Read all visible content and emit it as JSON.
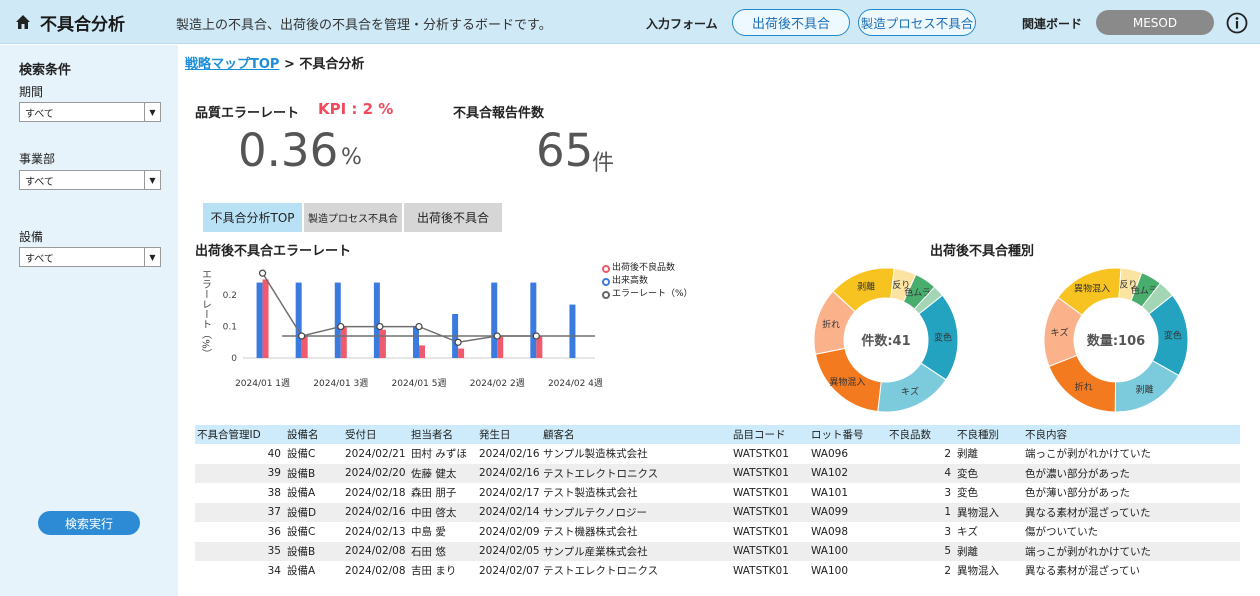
{
  "header": {
    "title": "不具合分析",
    "description": "製造上の不具合、出荷後の不具合を管理・分析するボードです。",
    "input_form_label": "入力フォーム",
    "btn_shipping": "出荷後不具合",
    "btn_process": "製造プロセス不具合",
    "related_board_label": "関連ボード",
    "mesod": "MESOD"
  },
  "sidebar": {
    "title": "検索条件",
    "period_label": "期間",
    "period_value": "すべて",
    "division_label": "事業部",
    "division_value": "すべて",
    "equipment_label": "設備",
    "equipment_value": "すべて",
    "search_button": "検索実行"
  },
  "breadcrumb": {
    "link": "戦略マップTOP",
    "separator": " > ",
    "current": "不具合分析"
  },
  "kpi": {
    "quality_label": "品質エラーレート",
    "kpi_target": "KPI : 2 %",
    "quality_value": "0.36",
    "quality_unit": "%",
    "report_label": "不具合報告件数",
    "report_value": "65",
    "report_unit": "件"
  },
  "tabs": [
    "不具合分析TOP",
    "製造プロセス不具合",
    "出荷後不具合"
  ],
  "colors": {
    "accent": "#2d8bd6",
    "bar_blue": "#3b7be0",
    "bar_red": "#ef5b6c",
    "line": "#707070"
  },
  "chart_data": [
    {
      "type": "bar",
      "title": "出荷後不具合エラーレート",
      "ylabel": "エラーレート（%）",
      "categories": [
        "2024/01 1週",
        "2024/01 2週",
        "2024/01 3週",
        "2024/01 4週",
        "2024/01 5週",
        "2024/02 1週",
        "2024/02 2週",
        "2024/02 3週",
        "2024/02 4週"
      ],
      "x_tick_labels": [
        "2024/01 1週",
        "2024/01 3週",
        "2024/01 5週",
        "2024/02 2週",
        "2024/02 4週"
      ],
      "yticks": [
        "0",
        "0.1",
        "0.2"
      ],
      "ylim": [
        0,
        0.28
      ],
      "series": [
        {
          "name": "出荷後不良品数",
          "values": [
            0.25,
            0.07,
            0.1,
            0.09,
            0.04,
            0.03,
            0.07,
            0.07,
            null
          ]
        },
        {
          "name": "出来高数",
          "values": [
            0.24,
            0.24,
            0.24,
            0.24,
            0.1,
            0.14,
            0.24,
            0.24,
            0.17
          ]
        },
        {
          "name": "エラーレート（%）",
          "values": [
            0.27,
            0.07,
            0.1,
            0.1,
            0.1,
            0.05,
            0.07,
            0.07,
            null
          ]
        }
      ],
      "reference_line": 0.07,
      "legend_position": "top-right"
    },
    {
      "type": "pie",
      "title": "出荷後不具合種別",
      "center_label": "件数:41",
      "slices": [
        {
          "label": "変色",
          "value": 8,
          "color": "#23a3c0"
        },
        {
          "label": "キズ",
          "value": 7,
          "color": "#7ccbdc"
        },
        {
          "label": "異物混入",
          "value": 8,
          "color": "#f47a20"
        },
        {
          "label": "折れ",
          "value": 6,
          "color": "#fbb18a"
        },
        {
          "label": "剥離",
          "value": 6,
          "color": "#f7c320"
        },
        {
          "label": "反り",
          "value": 2,
          "color": "#fbe3a2"
        },
        {
          "label": "色ムラ",
          "value": 2,
          "color": "#49ad6e"
        },
        {
          "label": "",
          "value": 1,
          "color": "#a3d6b4"
        }
      ]
    },
    {
      "type": "pie",
      "center_label": "数量:106",
      "slices": [
        {
          "label": "変色",
          "value": 20,
          "color": "#23a3c0"
        },
        {
          "label": "剥離",
          "value": 18,
          "color": "#7ccbdc"
        },
        {
          "label": "折れ",
          "value": 20,
          "color": "#f47a20"
        },
        {
          "label": "キズ",
          "value": 17,
          "color": "#fbb18a"
        },
        {
          "label": "異物混入",
          "value": 17,
          "color": "#f7c320"
        },
        {
          "label": "反り",
          "value": 5,
          "color": "#fbe3a2"
        },
        {
          "label": "色ムラ",
          "value": 5,
          "color": "#49ad6e"
        },
        {
          "label": "",
          "value": 4,
          "color": "#a3d6b4"
        }
      ]
    }
  ],
  "table": {
    "columns": [
      "不具合管理ID",
      "設備名",
      "受付日",
      "担当者名",
      "発生日",
      "顧客名",
      "品目コード",
      "ロット番号",
      "不良品数",
      "不良種別",
      "不良内容"
    ],
    "rows": [
      [
        "40",
        "設備C",
        "2024/02/21",
        "田村 みずほ",
        "2024/02/16",
        "サンプル製造株式会社",
        "WATSTK01",
        "WA096",
        "2",
        "剥離",
        "端っこが剥がれかけていた"
      ],
      [
        "39",
        "設備B",
        "2024/02/20",
        "佐藤 健太",
        "2024/02/16",
        "テストエレクトロニクス",
        "WATSTK01",
        "WA102",
        "4",
        "変色",
        "色が濃い部分があった"
      ],
      [
        "38",
        "設備A",
        "2024/02/18",
        "森田 朋子",
        "2024/02/17",
        "テスト製造株式会社",
        "WATSTK01",
        "WA101",
        "3",
        "変色",
        "色が薄い部分があった"
      ],
      [
        "37",
        "設備D",
        "2024/02/16",
        "中田 啓太",
        "2024/02/14",
        "サンプルテクノロジー",
        "WATSTK01",
        "WA099",
        "1",
        "異物混入",
        "異なる素材が混ざっていた"
      ],
      [
        "36",
        "設備C",
        "2024/02/13",
        "中島 愛",
        "2024/02/09",
        "テスト機器株式会社",
        "WATSTK01",
        "WA098",
        "3",
        "キズ",
        "傷がついていた"
      ],
      [
        "35",
        "設備B",
        "2024/02/08",
        "石田 悠",
        "2024/02/05",
        "サンプル産業株式会社",
        "WATSTK01",
        "WA100",
        "5",
        "剥離",
        "端っこが剥がれかけていた"
      ],
      [
        "34",
        "設備A",
        "2024/02/08",
        "吉田 まり",
        "2024/02/07",
        "テストエレクトロニクス",
        "WATSTK01",
        "WA100",
        "2",
        "異物混入",
        "異なる素材が混ざってい"
      ]
    ]
  }
}
